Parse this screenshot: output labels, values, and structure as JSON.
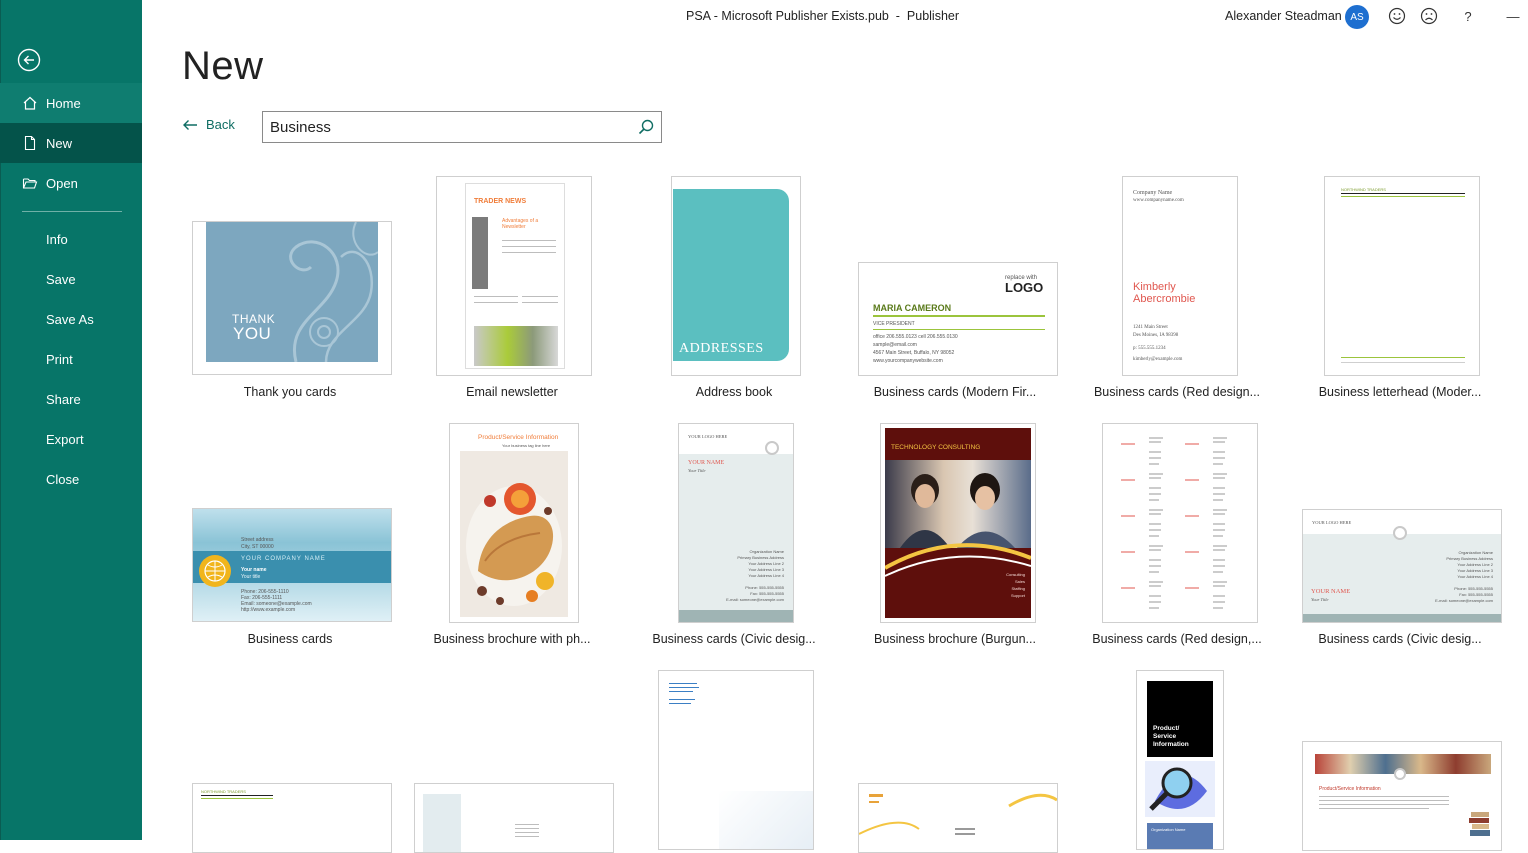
{
  "window": {
    "title": "PSA - Microsoft Publisher Exists.pub  -  Publisher",
    "user_name": "Alexander Steadman",
    "user_initials": "AS",
    "icons": [
      "smiley-icon",
      "frown-icon",
      "help-icon",
      "minimize-icon"
    ],
    "help_label": "?",
    "minimize_label": "—"
  },
  "sidebar": {
    "accent": "#077568",
    "items": [
      {
        "label": "Home"
      },
      {
        "label": "New"
      },
      {
        "label": "Open"
      },
      {
        "label": "Info"
      },
      {
        "label": "Save"
      },
      {
        "label": "Save As"
      },
      {
        "label": "Print"
      },
      {
        "label": "Share"
      },
      {
        "label": "Export"
      },
      {
        "label": "Close"
      }
    ]
  },
  "main": {
    "title": "New",
    "back_label": "Back",
    "search": {
      "value": "Business"
    }
  },
  "templates": [
    {
      "label": "Thank you cards",
      "thumb_text": [
        "THANK",
        "YOU"
      ]
    },
    {
      "label": "Email newsletter",
      "thumb_text": [
        "TRADER NEWS",
        "Advantages of a Newsletter"
      ]
    },
    {
      "label": "Address book",
      "thumb_text": [
        "ADDRESSES"
      ]
    },
    {
      "label": "Business cards (Modern Fir...",
      "thumb_text": [
        "replace with",
        "LOGO",
        "MARIA CAMERON",
        "VICE PRESIDENT",
        "office 206.555.0123  cell 206.555.0130",
        "sample@email.com",
        "4567 Main Street, Buffalo, NY 98052",
        "www.yourcompanywebsite.com"
      ]
    },
    {
      "label": "Business cards (Red design...",
      "thumb_text": [
        "Company Name",
        "www.companyname.com",
        "Kimberly",
        "Abercrombie",
        "1241 Main Street",
        "Des Moines, IA 98398",
        "p: 555.555.1234",
        "kimberly@example.com"
      ]
    },
    {
      "label": "Business letterhead (Moder...",
      "thumb_text": [
        "NORTHWIND TRADERS"
      ]
    },
    {
      "label": "Business cards",
      "thumb_text": [
        "Street address",
        "City, ST 00000",
        "YOUR COMPANY NAME",
        "Your name",
        "Your title",
        "Phone: 206-555-1110",
        "Fax: 206-555-1111",
        "Email: someone@example.com",
        "http://www.example.com"
      ]
    },
    {
      "label": "Business brochure with ph...",
      "thumb_text": [
        "Product/Service Information",
        "Your business tag line here"
      ]
    },
    {
      "label": "Business cards (Civic desig...",
      "thumb_text": [
        "YOUR LOGO HERE",
        "YOUR NAME",
        "Your Title",
        "Organization Name",
        "Primary Business Address",
        "Your Address Line 2",
        "Your Address Line 3",
        "Your Address Line 4",
        "Phone: 555-555-5555",
        "Fax: 555-555-5555",
        "E-mail: someone@example.com"
      ]
    },
    {
      "label": "Business brochure (Burgun...",
      "thumb_text": [
        "TECHNOLOGY CONSULTING",
        "Consulting",
        "Sales",
        "Staffing",
        "Support"
      ]
    },
    {
      "label": "Business cards (Red design,...",
      "thumb_text": []
    },
    {
      "label": "Business cards (Civic desig...",
      "thumb_text": [
        "YOUR LOGO HERE",
        "YOUR NAME",
        "Your Title",
        "Organization Name",
        "Primary Business Address",
        "Your Address Line 2",
        "Your Address Line 3",
        "Your Address Line 4",
        "Phone: 555-555-5555",
        "Fax: 555-555-5555",
        "E-mail: someone@example.com"
      ]
    },
    {
      "label": "",
      "thumb_text": [
        "NORTHWIND TRADERS"
      ]
    },
    {
      "label": "",
      "thumb_text": []
    },
    {
      "label": "",
      "thumb_text": []
    },
    {
      "label": "",
      "thumb_text": []
    },
    {
      "label": "",
      "thumb_text": [
        "Product/",
        "Service",
        "Information",
        "Organization Name"
      ]
    },
    {
      "label": "",
      "thumb_text": [
        "Product/Service Information"
      ]
    }
  ]
}
